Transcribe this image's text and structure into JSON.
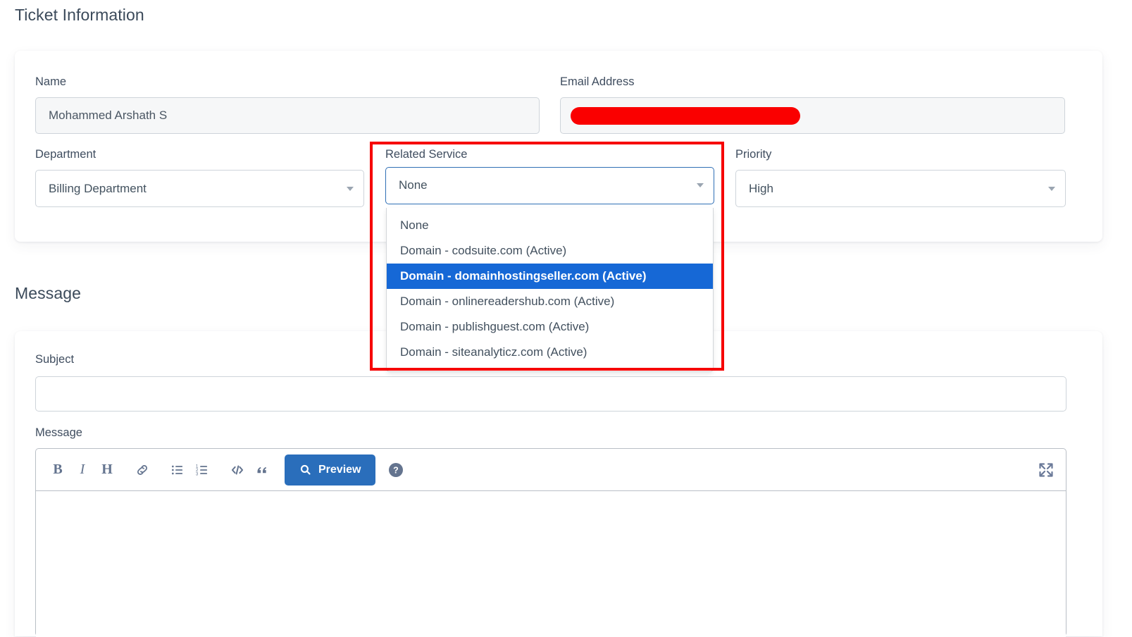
{
  "sections": {
    "ticket_information_title": "Ticket Information",
    "message_title": "Message"
  },
  "ticket_form": {
    "name": {
      "label": "Name",
      "value": "Mohammed  Arshath S",
      "readonly": true
    },
    "email": {
      "label": "Email Address",
      "value": "",
      "redacted": true,
      "redaction_color": "#fa0000",
      "readonly": true
    },
    "department": {
      "label": "Department",
      "selected": "Billing Department"
    },
    "related_service": {
      "label": "Related Service",
      "selected": "None",
      "open": true,
      "highlighted_index": 2,
      "highlight_color": "#1668d6",
      "focus_border_color": "#2f6fb5",
      "options": [
        "None",
        "Domain - codsuite.com (Active)",
        "Domain - domainhostingseller.com (Active)",
        "Domain - onlinereadershub.com (Active)",
        "Domain - publishguest.com (Active)",
        "Domain - siteanalyticz.com (Active)"
      ]
    },
    "priority": {
      "label": "Priority",
      "selected": "High"
    }
  },
  "message_form": {
    "subject": {
      "label": "Subject",
      "value": "",
      "placeholder": ""
    },
    "message": {
      "label": "Message",
      "value": "",
      "placeholder": ""
    },
    "toolbar": {
      "bold_label": "B",
      "italic_label": "I",
      "heading_label": "H",
      "link_icon": "link-icon",
      "unordered_list_icon": "unordered-list-icon",
      "ordered_list_icon": "ordered-list-icon",
      "code_label": "</>",
      "quote_label": "“",
      "preview_label": "Preview",
      "preview_icon": "search-icon",
      "help_icon": "question-circle-icon",
      "expand_icon": "expand-arrows-icon",
      "preview_button_color": "#2a6ebb"
    }
  },
  "annotation": {
    "type": "rectangle-highlight",
    "color": "#f60000",
    "target": "Related Service dropdown"
  }
}
